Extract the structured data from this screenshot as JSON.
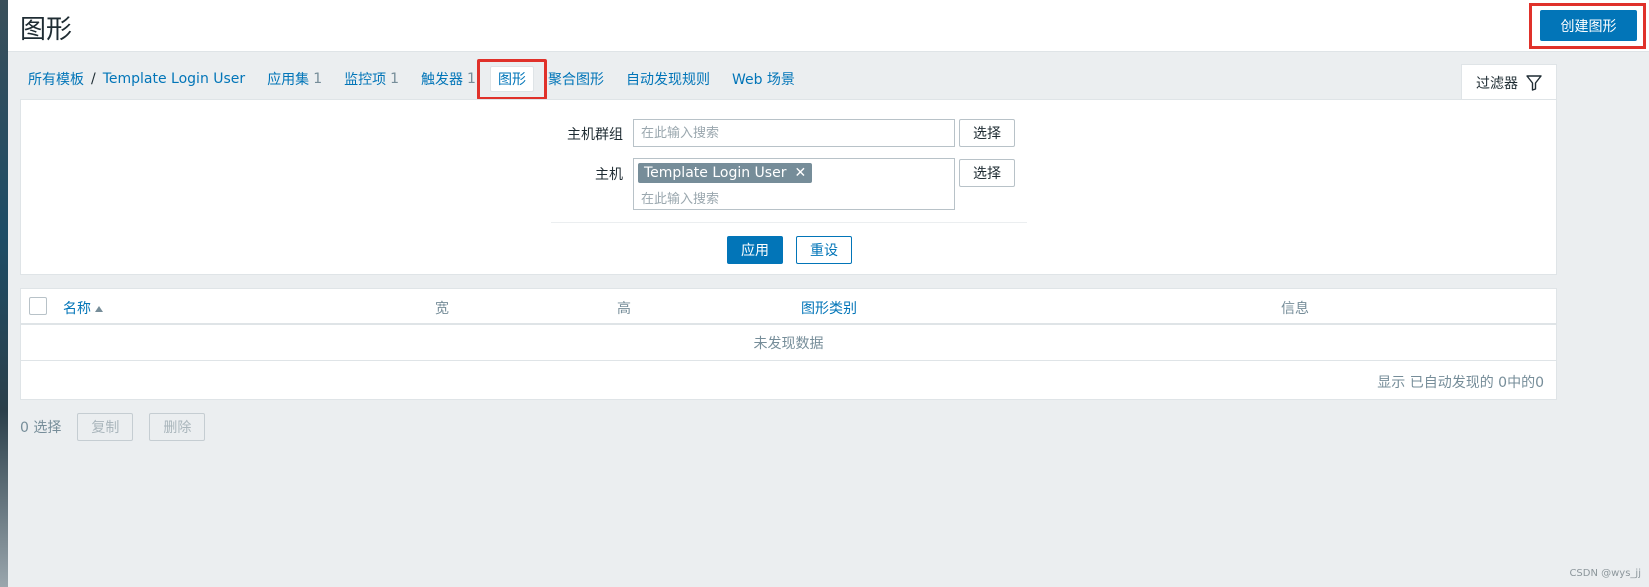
{
  "header": {
    "title": "图形",
    "create_button": "创建图形"
  },
  "nav": {
    "all_templates": "所有模板",
    "template_name": "Template Login User",
    "applications": {
      "label": "应用集",
      "count": "1"
    },
    "items": {
      "label": "监控项",
      "count": "1"
    },
    "triggers": {
      "label": "触发器",
      "count": "1"
    },
    "graphs": "图形",
    "screens": "聚合图形",
    "discovery": "自动发现规则",
    "web": "Web 场景"
  },
  "filter": {
    "tab_label": "过滤器",
    "host_group_label": "主机群组",
    "host_group_placeholder": "在此输入搜索",
    "host_label": "主机",
    "host_tag": "Template Login User",
    "host_placeholder": "在此输入搜索",
    "select_label": "选择",
    "apply_label": "应用",
    "reset_label": "重设"
  },
  "table": {
    "columns": {
      "name": "名称",
      "width": "宽",
      "height": "高",
      "graph_type": "图形类别",
      "info": "信息"
    },
    "empty_message": "未发现数据",
    "footer": "显示 已自动发现的 0中的0"
  },
  "actions": {
    "selected_count": "0 选择",
    "copy": "复制",
    "delete": "删除"
  },
  "watermark": "CSDN @wys_jj",
  "colors": {
    "accent": "#0275b8",
    "highlight": "#e0312a",
    "muted": "#768d99"
  }
}
